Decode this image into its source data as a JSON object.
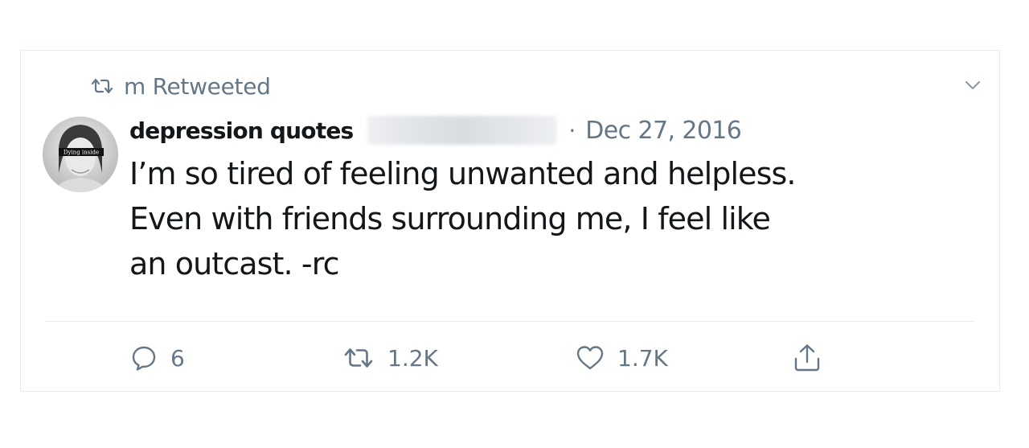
{
  "retweet_banner": {
    "icon": "retweet-icon",
    "text": "m Retweeted"
  },
  "tweet": {
    "display_name": "depression quotes",
    "separator": "·",
    "date": "Dec 27, 2016",
    "avatar_caption": "Dying inside",
    "text_lines": [
      "I’m so tired of feeling unwanted and helpless.",
      "Even with friends surrounding me, I feel like",
      "an outcast. -rc"
    ]
  },
  "actions": {
    "reply": {
      "icon": "reply-icon",
      "count": "6"
    },
    "retweet": {
      "icon": "retweet-icon",
      "count": "1.2K"
    },
    "like": {
      "icon": "heart-icon",
      "count": "1.7K"
    },
    "share": {
      "icon": "share-icon"
    }
  },
  "colors": {
    "text_primary": "#14171a",
    "text_secondary": "#657786",
    "border": "#e6ecf0"
  }
}
